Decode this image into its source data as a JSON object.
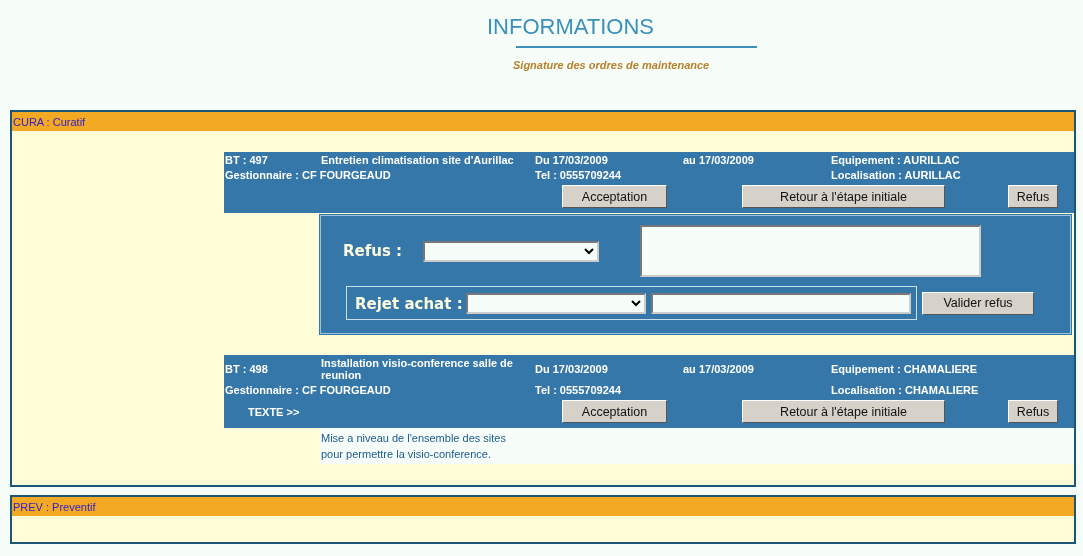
{
  "header": {
    "title": "INFORMATIONS",
    "subtitle": "Signature des ordres de maintenance"
  },
  "sections": [
    {
      "label": "CURA : Curatif",
      "orders": [
        {
          "bt": "BT : 497",
          "description": "Entretien climatisation site d'Aurillac",
          "manager": "Gestionnaire : CF FOURGEAUD",
          "start": "Du 17/03/2009",
          "end": "au 17/03/2009",
          "phone": "Tel : 0555709244",
          "equipment": "Equipement : AURILLAC",
          "location": "Localisation : AURILLAC",
          "buttons": [
            "Acceptation",
            "Retour à l'étape initiale",
            "Refus"
          ],
          "refusal_form": {
            "refus_label": "Refus :",
            "reject_label": "Rejet achat :",
            "submit": "Valider refus"
          }
        },
        {
          "bt": "BT : 498",
          "description": "Installation visio-conference salle de reunion",
          "manager": "Gestionnaire : CF FOURGEAUD",
          "start": "Du 17/03/2009",
          "end": "au 17/03/2009",
          "phone": "Tel : 0555709244",
          "equipment": "Equipement : CHAMALIERE",
          "location": "Localisation : CHAMALIERE",
          "text_toggle": "TEXTE >>",
          "buttons": [
            "Acceptation",
            "Retour à l'étape initiale",
            "Refus"
          ],
          "text": "Mise a niveau de l'ensemble des sites pour permettre la visio-conference."
        }
      ]
    },
    {
      "label": "PREV : Preventif"
    }
  ]
}
